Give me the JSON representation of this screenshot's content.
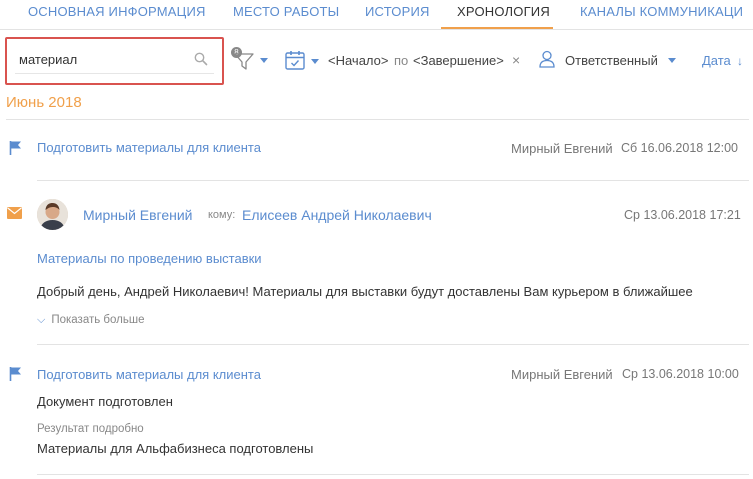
{
  "tabs": [
    {
      "label": "ОСНОВНАЯ ИНФОРМАЦИЯ",
      "active": false
    },
    {
      "label": "МЕСТО РАБОТЫ",
      "active": false
    },
    {
      "label": "ИСТОРИЯ",
      "active": false
    },
    {
      "label": "ХРОНОЛОГИЯ",
      "active": true
    },
    {
      "label": "КАНАЛЫ КОММУНИКАЦИ",
      "active": false
    }
  ],
  "colors": {
    "accent": "#f0a04b",
    "link": "#5b8ccf",
    "highlight": "#d9534f"
  },
  "filters": {
    "search_value": "материал",
    "filter_count": "8",
    "period_start": "<Начало>",
    "period_sep": "по",
    "period_end": "<Завершение>",
    "clear_icon": "×",
    "owner_label": "Ответственный",
    "sort_label": "Дата",
    "sort_arrow": "↓"
  },
  "month_label": "Июнь 2018",
  "items": [
    {
      "type": "task",
      "icon": "flag-icon",
      "title": "Подготовить материалы для клиента",
      "owner": "Мирный Евгений",
      "date": "Сб 16.06.2018 12:00"
    },
    {
      "type": "email",
      "icon": "envelope-icon",
      "sender": "Мирный Евгений",
      "to_label": "кому:",
      "recipient": "Елисеев Андрей Николаевич",
      "date": "Ср 13.06.2018 17:21",
      "subject": "Материалы по проведению выставки",
      "body": "Добрый день, Андрей Николаевич! Материалы для выставки будут доставлены Вам курьером в ближайшее",
      "show_more": "Показать больше",
      "show_more_icon": "⌵"
    },
    {
      "type": "task",
      "icon": "flag-icon",
      "title": "Подготовить материалы для клиента",
      "owner": "Мирный Евгений",
      "date": "Ср 13.06.2018 10:00",
      "description": "Документ подготовлен",
      "result_label": "Результат подробно",
      "result_value": "Материалы для Альфабизнеса подготовлены"
    }
  ]
}
